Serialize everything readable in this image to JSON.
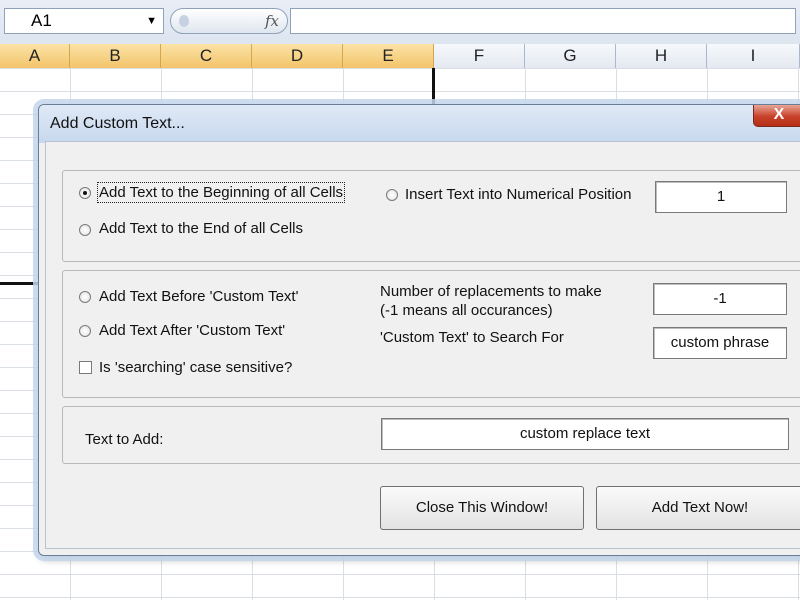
{
  "excel": {
    "name_box": "A1",
    "fx_label": "fx",
    "columns": [
      "A",
      "B",
      "C",
      "D",
      "E",
      "F",
      "G",
      "H",
      "I"
    ]
  },
  "dialog": {
    "title": "Add Custom Text...",
    "close_label": "X",
    "group1": {
      "radio_beginning": "Add Text to the Beginning of all Cells",
      "radio_end": "Add Text to the End of all Cells",
      "radio_numerical": "Insert Text into Numerical Position",
      "position_value": "1"
    },
    "group2": {
      "radio_before": "Add Text Before 'Custom Text'",
      "radio_after": "Add Text After 'Custom Text'",
      "checkbox_case": "Is 'searching' case sensitive?",
      "replacements_label_1": "Number of replacements to make",
      "replacements_label_2": "(-1 means all occurances)",
      "replacements_value": "-1",
      "search_label": "'Custom Text' to Search For",
      "search_value": "custom phrase"
    },
    "group3": {
      "text_to_add_label": "Text to Add:",
      "text_to_add_value": "custom replace text"
    },
    "buttons": {
      "close_window": "Close This Window!",
      "add_text": "Add Text Now!"
    }
  }
}
